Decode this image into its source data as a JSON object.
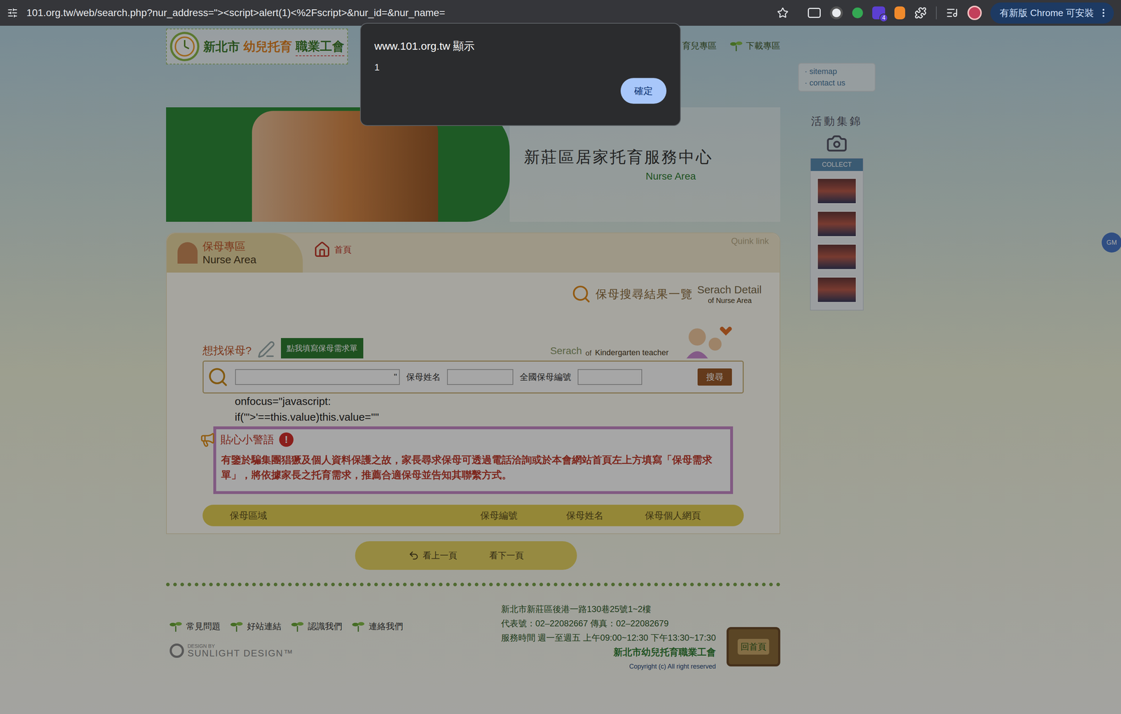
{
  "browser": {
    "url": "101.org.tw/web/search.php?nur_address=\"><script>alert(1)<%2Fscript>&nur_id=&nur_name=",
    "extension_badge": "4",
    "update_button": "有新版 Chrome 可安裝"
  },
  "dialog": {
    "title": "www.101.org.tw 顯示",
    "message": "1",
    "button": "確定"
  },
  "header": {
    "logo": [
      "新北市",
      "幼兒托育",
      "職業工會"
    ],
    "nav": [
      "育兒專區",
      "下載專區"
    ],
    "links": [
      "sitemap",
      "contact us"
    ]
  },
  "banner": {
    "title": "新莊區居家托育服務中心",
    "subtitle": "Nurse Area"
  },
  "sidebar": {
    "title": "活動集錦",
    "label": "COLLECT"
  },
  "panel": {
    "tab_title": "保母專區",
    "tab_subtitle": "Nurse Area",
    "home": "首頁",
    "quick_link": "Quink link",
    "heading": "保母搜尋結果一覽",
    "heading_en": "Serach Detail",
    "heading_en_sub": "of Nurse Area"
  },
  "search": {
    "prompt": "想找保母?",
    "request_button": "點我填寫保母需求單",
    "caption_main": "Serach",
    "caption_of": "of",
    "caption_rest": "Kindergarten teacher",
    "address_value": "\"",
    "name_label": "保母姓名",
    "name_value": "",
    "id_label": "全國保母編號",
    "id_value": "",
    "submit": "搜尋",
    "leaked": [
      "onfocus=\"javascript:",
      "if('\">'==this.value)this.value=''\""
    ]
  },
  "warning": {
    "title": "貼心小警語",
    "icon": "!",
    "text": "有鑒於騙集團猖獗及個人資料保護之故，家長尋求保母可透過電話洽詢或於本會網站首頁左上方填寫「保母需求單」，將依據家長之托育需求，推薦合適保母並告知其聯繫方式。"
  },
  "table": {
    "columns": [
      "保母區域",
      "保母編號",
      "保母姓名",
      "保母個人網頁"
    ],
    "rows": []
  },
  "pager": [
    "看上一頁",
    "看下一頁"
  ],
  "footer": {
    "links": [
      "常見問題",
      "好站連結",
      "認識我們",
      "連絡我們"
    ],
    "design_by": "DESIGN BY",
    "designer": "SUNLIGHT DESIGN™",
    "address": "新北市新莊區後港一路130巷25號1~2樓",
    "phone": "代表號：02–22082667 傳真：02–22082679",
    "hours": "服務時間 週一至週五 上午09:00~12:30 下午13:30~17:30",
    "org": "新北市幼兒托育職業工會",
    "copyright": "Copyright (c) All right reserved",
    "home": "回首頁"
  },
  "side_badge": "GM"
}
